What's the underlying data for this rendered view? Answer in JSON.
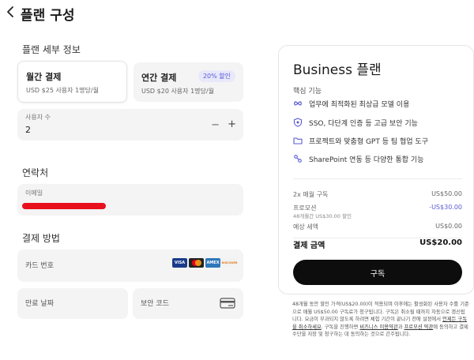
{
  "header": {
    "title": "플랜 구성"
  },
  "plan_details": {
    "title": "플랜 세부 정보",
    "monthly": {
      "title": "월간 결제",
      "price": "USD $25 사용자 1명당/월"
    },
    "annual": {
      "title": "연간 결제",
      "price": "USD $20 사용자 1명당/월",
      "badge": "20% 할인"
    },
    "users": {
      "label": "사용자 수",
      "value": "2",
      "minus": "−",
      "plus": "+"
    }
  },
  "contact": {
    "title": "연락처",
    "email_label": "이메일"
  },
  "payment": {
    "title": "결제 방법",
    "card_number_label": "카드 번호",
    "brands": [
      "VISA",
      "MC",
      "AMEX",
      "DISCOVER"
    ],
    "expiry_label": "만료 날짜",
    "cvc_label": "보안 코드"
  },
  "summary": {
    "plan_name": "Business 플랜",
    "features_title": "핵심 기능",
    "features": [
      {
        "icon": "infinity-icon",
        "text": "업무에 최적화된 최상급 모델 이용"
      },
      {
        "icon": "shield-icon",
        "text": "SSO, 다단계 인증 등 고급 보안 기능"
      },
      {
        "icon": "folder-icon",
        "text": "프로젝트와 맞춤형 GPT 등 팀 협업 도구"
      },
      {
        "icon": "link-icon",
        "text": "SharePoint 연동 등 다양한 통합 기능"
      }
    ],
    "rows": {
      "subscription": {
        "label": "2x 매월 구독",
        "amount": "US$50.00"
      },
      "promotion": {
        "label": "프로모션",
        "amount": "-US$30.00",
        "detail": "48개월간 US$30.00 할인"
      },
      "tax": {
        "label": "예상 세액",
        "amount": "US$0.00"
      }
    },
    "total": {
      "label": "결제 금액",
      "amount": "US$20.00"
    },
    "subscribe_label": "구독"
  },
  "legal": {
    "text1": "48개월 동안 할인 가격(US$20.00)이 적용되며 이후에는 활성화된 사용자 수를 기준으로 매월 US$50.00 구독료가 청구됩니다. 구독은 취소될 때까지 자동으로 갱신됩니다. 요금이 부과되지 않도록 하려면 체험 기간이 끝나기 전에 설정에서 ",
    "link1": "언제든 구독을 취소하세요",
    "text2": ". 구독을 진행하면 ",
    "link2": "비즈니스 이용약관",
    "text3": "과 ",
    "link3": "프로모션 약관",
    "text4": "에 동의하고 결제 수단을 저장 및 청구하는 데 동의하는 것으로 간주됩니다."
  },
  "colors": {
    "accent": "#5b5bd6",
    "button": "#0d0d0d",
    "redaction": "#e8101c"
  }
}
